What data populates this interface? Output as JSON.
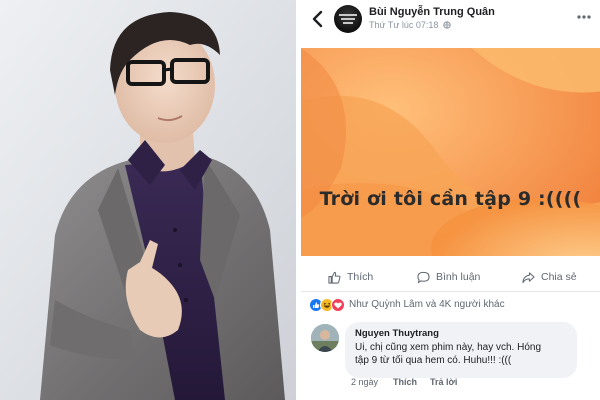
{
  "post": {
    "author": "Bùi Nguyễn Trung Quân",
    "timestamp": "Thứ Tư lúc 07:18",
    "caption": "Trời ơi tôi cần tập 9 :((((",
    "image_bg_color": "#f6a35a"
  },
  "actions": {
    "like": "Thích",
    "comment": "Bình luận",
    "share": "Chia sẻ"
  },
  "reactions": {
    "summary": "Như Quỳnh Lâm và 4K người khác",
    "types": [
      "like-icon",
      "haha-icon",
      "love-icon"
    ]
  },
  "comment": {
    "author": "Nguyen Thuytrang",
    "text_line1": "Ui, chị cũng xem phim này, hay vch. Hóng",
    "text_line2": "tập 9 từ tối qua hem có. Huhu!!! :(((",
    "age": "2 ngày",
    "like_label": "Thích",
    "reply_label": "Trả lời"
  },
  "icons": {
    "back": "back-arrow-icon",
    "more": "more-options-icon",
    "privacy": "globe-icon"
  },
  "colors": {
    "fb_blue": "#1877f2",
    "text_primary": "#1c1e21",
    "text_secondary": "#606770",
    "comment_bubble": "#f0f2f5"
  }
}
